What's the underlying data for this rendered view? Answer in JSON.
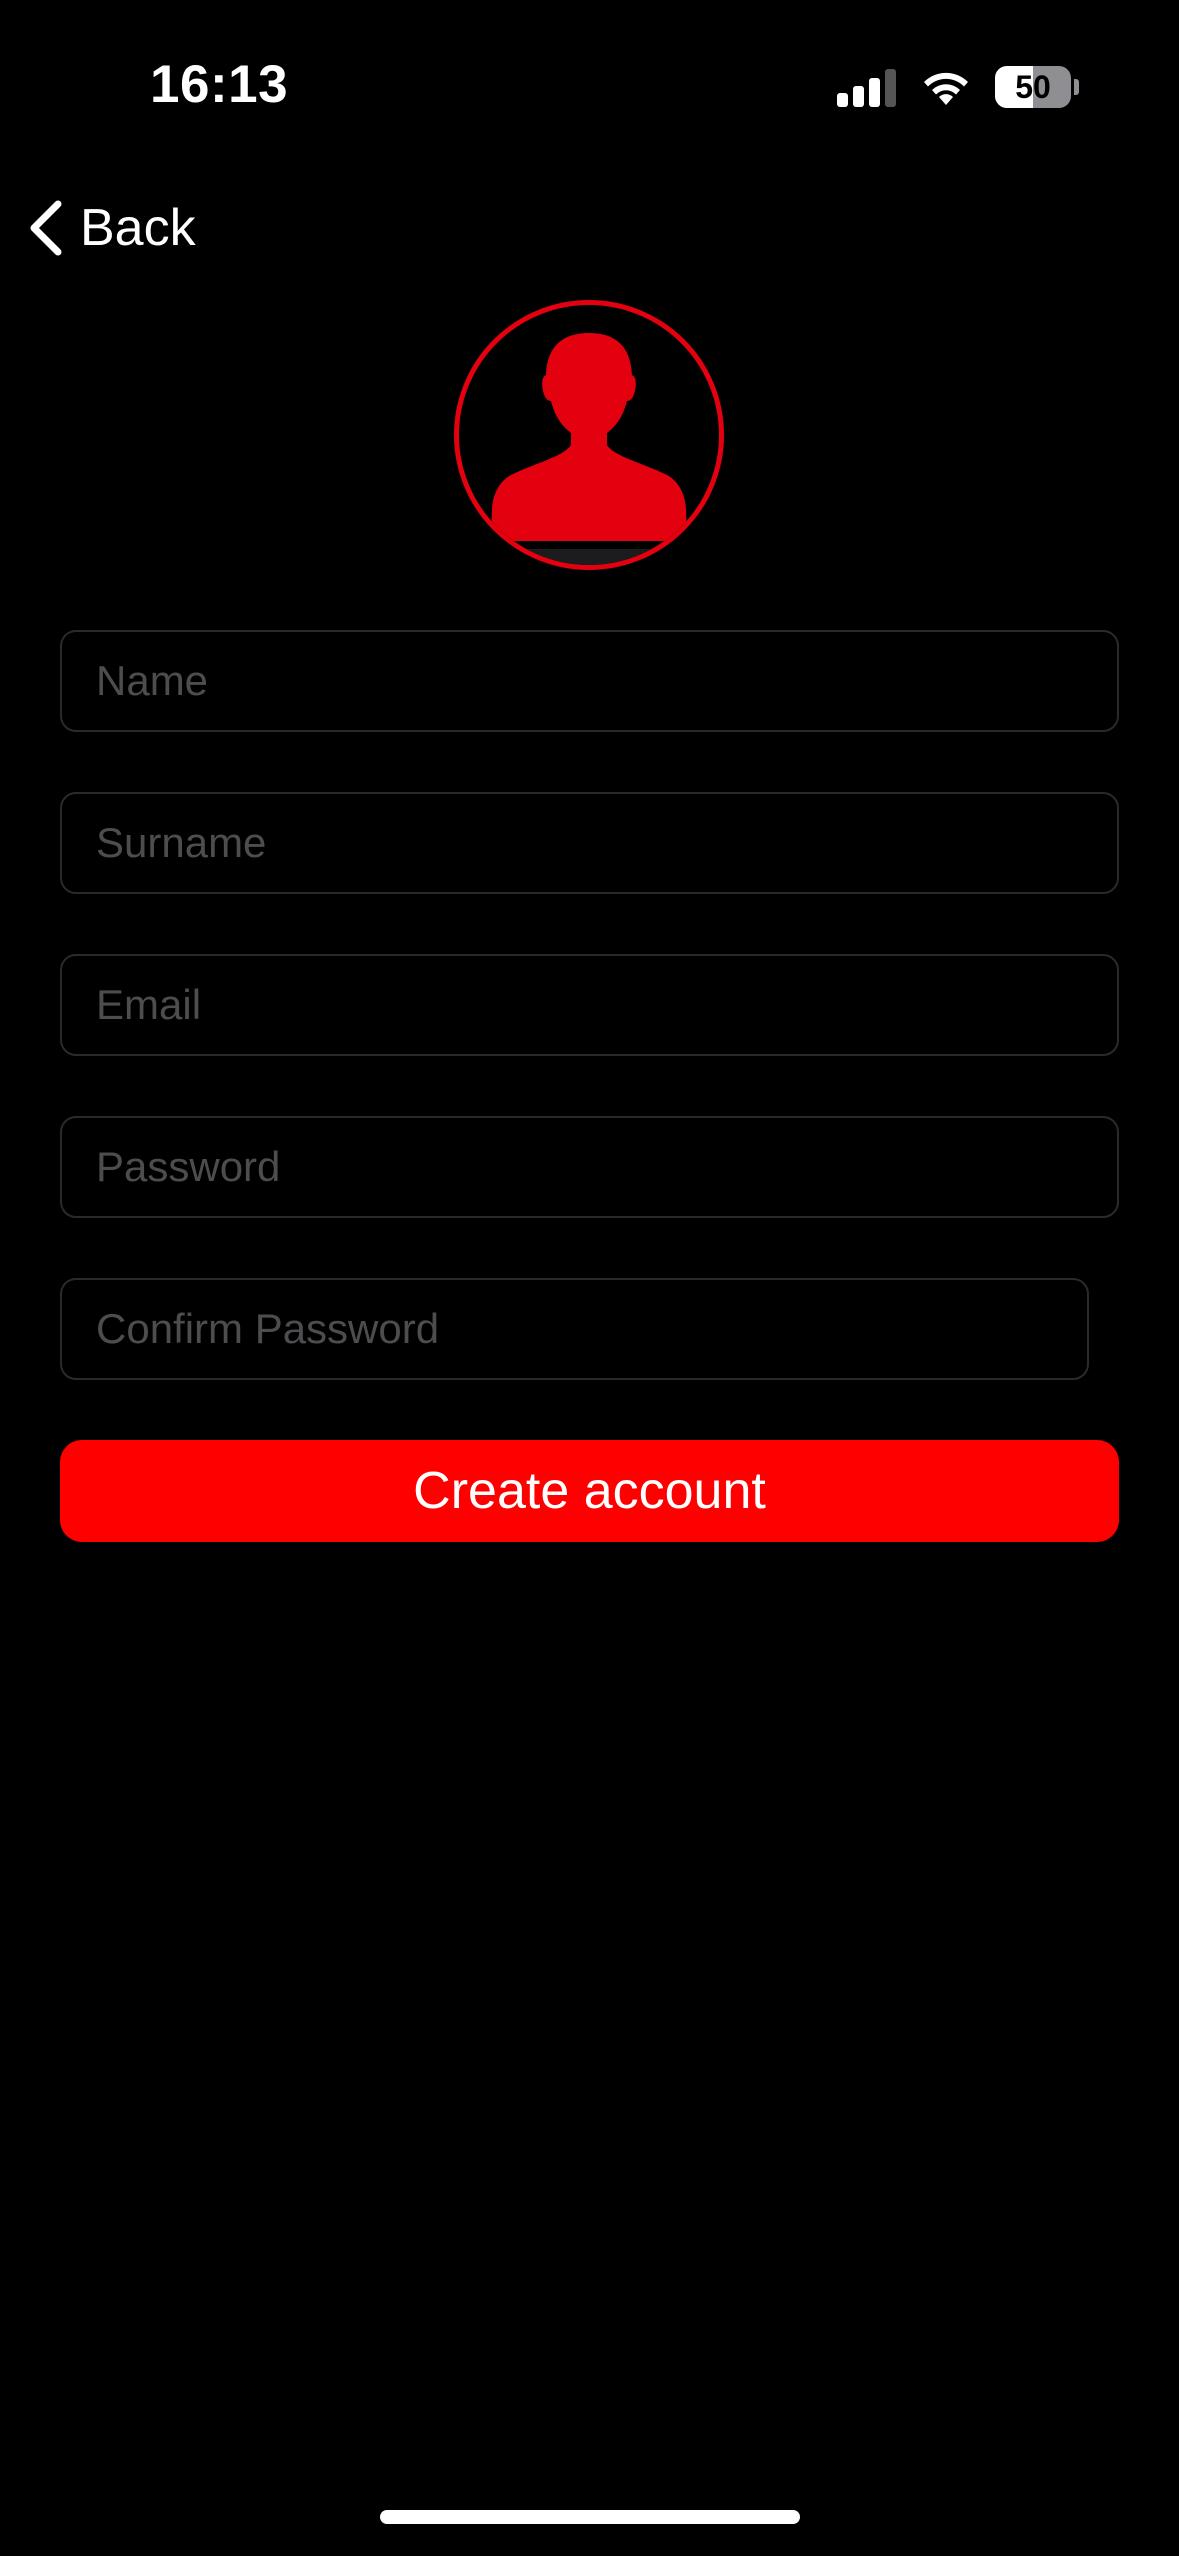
{
  "status_bar": {
    "time": "16:13",
    "battery_level": "50",
    "battery_fraction": 0.5
  },
  "nav": {
    "back_label": "Back"
  },
  "avatar": {
    "icon": "person-silhouette-icon",
    "accent_color": "#e3000f"
  },
  "form": {
    "name_placeholder": "Name",
    "surname_placeholder": "Surname",
    "email_placeholder": "Email",
    "password_placeholder": "Password",
    "confirm_password_placeholder": "Confirm Password",
    "name_value": "",
    "surname_value": "",
    "email_value": "",
    "password_value": "",
    "confirm_password_value": ""
  },
  "actions": {
    "create_account_label": "Create account",
    "button_color": "#ff0000"
  }
}
